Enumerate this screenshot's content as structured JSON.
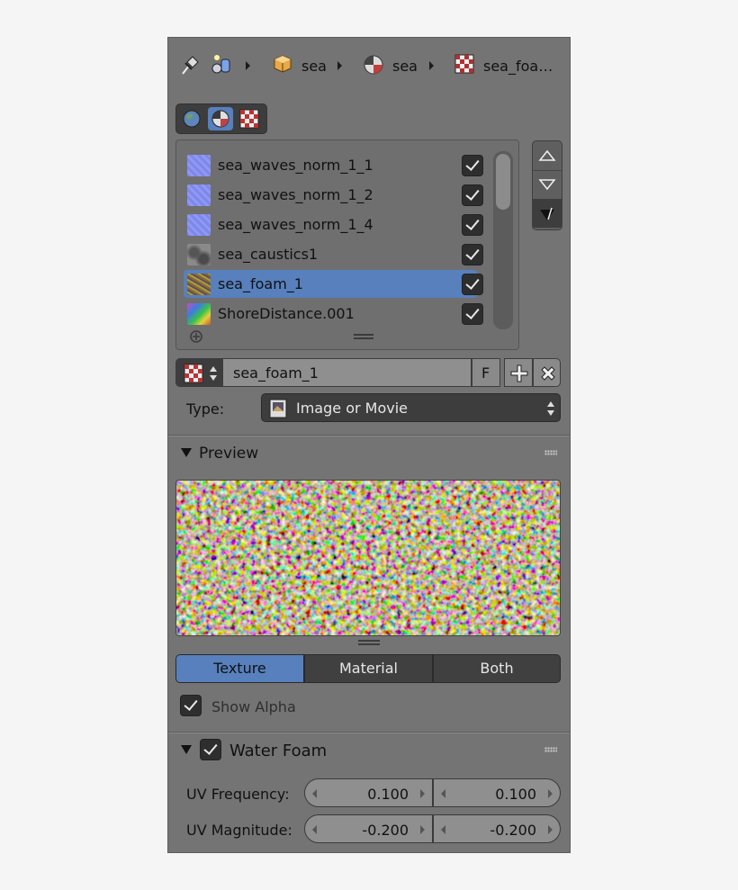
{
  "breadcrumb": {
    "items": [
      "sea",
      "sea",
      "sea_foa…"
    ]
  },
  "texture_slots": [
    {
      "name": "sea_waves_norm_1_1",
      "enabled": true,
      "selected": false,
      "thumb": "normal-map"
    },
    {
      "name": "sea_waves_norm_1_2",
      "enabled": true,
      "selected": false,
      "thumb": "normal-map"
    },
    {
      "name": "sea_waves_norm_1_4",
      "enabled": true,
      "selected": false,
      "thumb": "normal-map"
    },
    {
      "name": "sea_caustics1",
      "enabled": true,
      "selected": false,
      "thumb": "caustics"
    },
    {
      "name": "sea_foam_1",
      "enabled": true,
      "selected": true,
      "thumb": "foam"
    },
    {
      "name": "ShoreDistance.001",
      "enabled": true,
      "selected": false,
      "thumb": "shore"
    }
  ],
  "texture_block": {
    "name": "sea_foam_1",
    "fake_user_label": "F"
  },
  "type_row": {
    "label": "Type:",
    "value": "Image or Movie"
  },
  "preview": {
    "header": "Preview",
    "tabs": [
      {
        "label": "Texture",
        "active": true
      },
      {
        "label": "Material",
        "active": false
      },
      {
        "label": "Both",
        "active": false
      }
    ],
    "show_alpha_label": "Show Alpha",
    "show_alpha_checked": true
  },
  "water_foam": {
    "header": "Water Foam",
    "enabled": true,
    "uv_frequency_label": "UV Frequency:",
    "uv_frequency": [
      "0.100",
      "0.100"
    ],
    "uv_magnitude_label": "UV Magnitude:",
    "uv_magnitude": [
      "-0.200",
      "-0.200"
    ]
  },
  "colors": {
    "panel_bg": "#747474",
    "accent": "#5780bd",
    "button_dark": "#3d3d3d"
  }
}
